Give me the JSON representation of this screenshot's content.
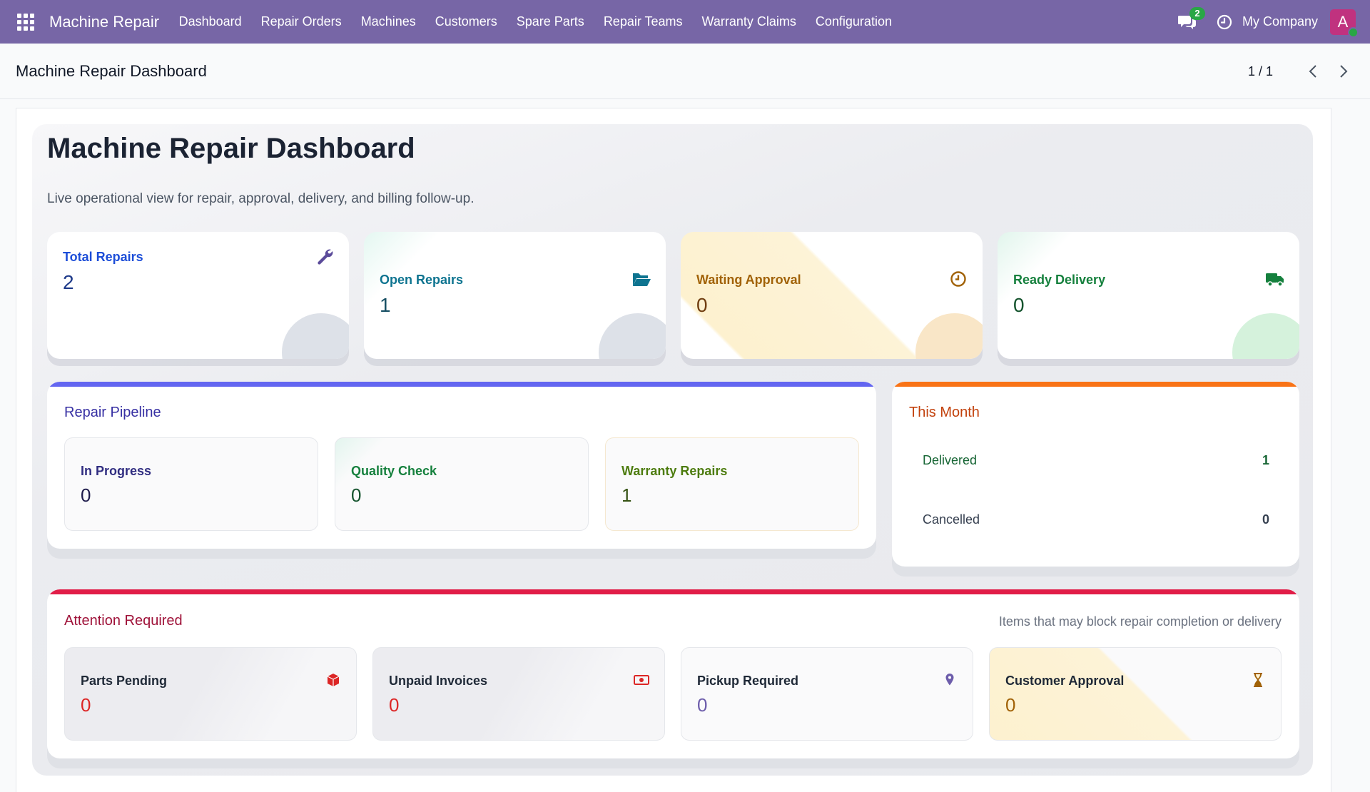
{
  "navbar": {
    "brand": "Machine Repair",
    "menu": [
      "Dashboard",
      "Repair Orders",
      "Machines",
      "Customers",
      "Spare Parts",
      "Repair Teams",
      "Warranty Claims",
      "Configuration"
    ],
    "chat_badge": "2",
    "company": "My Company",
    "avatar_letter": "A"
  },
  "control_panel": {
    "breadcrumb": "Machine Repair Dashboard",
    "pager": "1 / 1"
  },
  "dashboard": {
    "title": "Machine Repair Dashboard",
    "subtitle": "Live operational view for repair, approval, delivery, and billing follow-up.",
    "kpis": [
      {
        "label": "Total Repairs",
        "value": "2",
        "icon": "wrench-icon"
      },
      {
        "label": "Open Repairs",
        "value": "1",
        "icon": "folder-open-icon"
      },
      {
        "label": "Waiting Approval",
        "value": "0",
        "icon": "clock-icon"
      },
      {
        "label": "Ready Delivery",
        "value": "0",
        "icon": "truck-icon"
      }
    ],
    "pipeline": {
      "title": "Repair Pipeline",
      "items": [
        {
          "label": "In Progress",
          "value": "0"
        },
        {
          "label": "Quality Check",
          "value": "0"
        },
        {
          "label": "Warranty Repairs",
          "value": "1"
        }
      ]
    },
    "this_month": {
      "title": "This Month",
      "rows": [
        {
          "label": "Delivered",
          "value": "1"
        },
        {
          "label": "Cancelled",
          "value": "0"
        }
      ]
    },
    "attention": {
      "title": "Attention Required",
      "note": "Items that may block repair completion or delivery",
      "items": [
        {
          "label": "Parts Pending",
          "value": "0",
          "icon": "cube-icon"
        },
        {
          "label": "Unpaid Invoices",
          "value": "0",
          "icon": "money-icon"
        },
        {
          "label": "Pickup Required",
          "value": "0",
          "icon": "map-pin-icon"
        },
        {
          "label": "Customer Approval",
          "value": "0",
          "icon": "hourglass-icon"
        }
      ]
    }
  },
  "colors": {
    "navbar": "#7766a6",
    "pipeline_bar": "#6366f1",
    "month_bar": "#f97316",
    "attention_bar": "#e11d48"
  }
}
